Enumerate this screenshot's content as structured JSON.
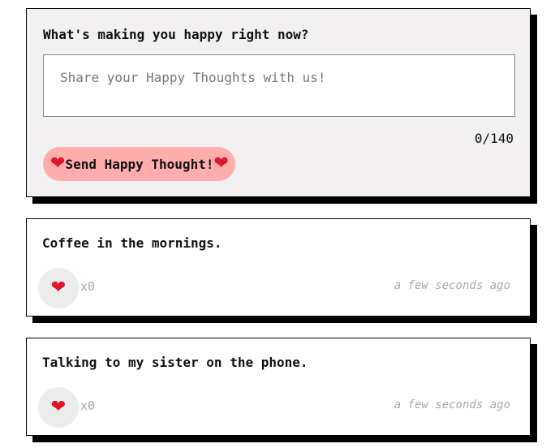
{
  "form": {
    "title": "What's making you happy right now?",
    "input_placeholder": "Share your Happy Thoughts with us!",
    "input_value": "",
    "char_counter": "0/140",
    "send_label": "Send Happy Thought!",
    "heart_glyph": "❤",
    "button_color": "#ffadad"
  },
  "posts": [
    {
      "text": "Coffee in the mornings.",
      "like_count": "x0",
      "timestamp": "a few seconds ago"
    },
    {
      "text": "Talking to my sister on the phone.",
      "like_count": "x0",
      "timestamp": "a few seconds ago"
    }
  ],
  "icons": {
    "heart": "heart-icon"
  },
  "colors": {
    "heart": "#e0142a",
    "form_background": "#f2f0f0",
    "shadow": "#000000",
    "muted_text": "#a8a8a8"
  }
}
